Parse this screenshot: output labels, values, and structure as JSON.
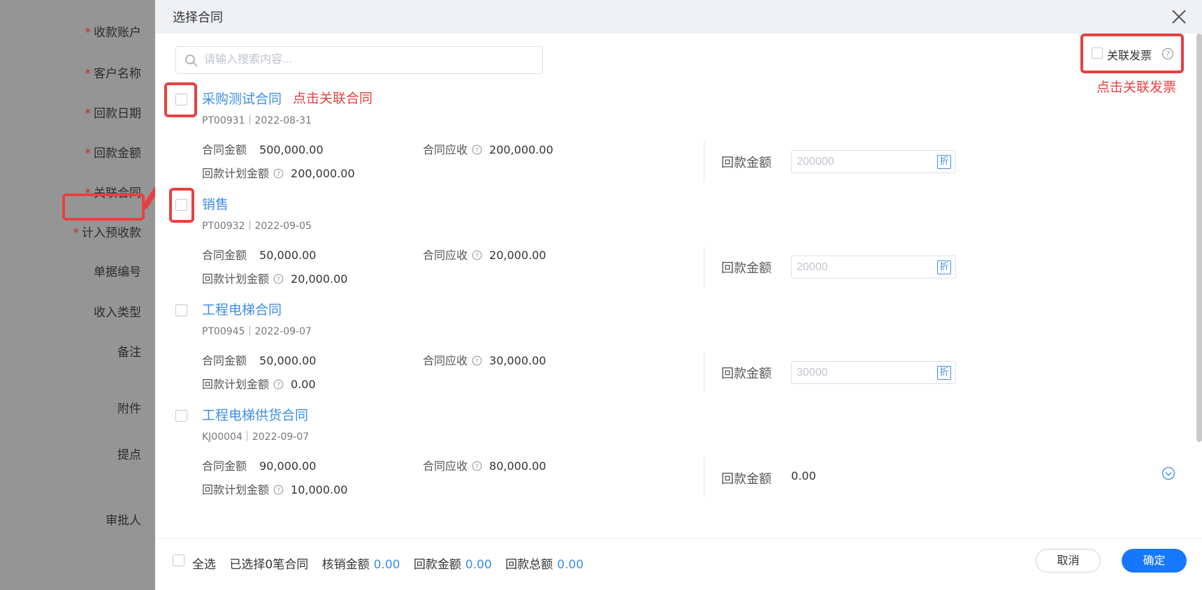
{
  "form": {
    "fields": [
      {
        "label": "收款账户",
        "required": true
      },
      {
        "label": "客户名称",
        "required": true
      },
      {
        "label": "回款日期",
        "required": true
      },
      {
        "label": "回款金额",
        "required": true
      },
      {
        "label": "关联合同",
        "required": true
      },
      {
        "label": "计入预收款",
        "required": true
      },
      {
        "label": "单据编号",
        "required": false
      },
      {
        "label": "收入类型",
        "required": false
      },
      {
        "label": "备注",
        "required": false
      },
      {
        "label": "附件",
        "required": false
      },
      {
        "label": "提点",
        "required": false
      },
      {
        "label": "审批人",
        "required": false
      }
    ],
    "required_mark": "*"
  },
  "modal": {
    "title": "选择合同",
    "search_placeholder": "请输入搜索内容...",
    "invoice_label": "关联发票",
    "invoice_note": "点击关联发票",
    "contract_note": "点击关联合同",
    "labels": {
      "contract_amount": "合同金额",
      "receivable": "合同应收",
      "plan_amount": "回款计划金额",
      "payment_amount": "回款金额"
    },
    "contracts": [
      {
        "name": "采购测试合同",
        "meta": "PT00931｜2022-08-31",
        "amount": "500,000.00",
        "receivable": "200,000.00",
        "plan": "200,000.00",
        "payment_placeholder": "200000",
        "discount_icon": "折"
      },
      {
        "name": "销售",
        "meta": "PT00932｜2022-09-05",
        "amount": "50,000.00",
        "receivable": "20,000.00",
        "plan": "20,000.00",
        "payment_placeholder": "20000",
        "discount_icon": "折"
      },
      {
        "name": "工程电梯合同",
        "meta": "PT00945｜2022-09-07",
        "amount": "50,000.00",
        "receivable": "30,000.00",
        "plan": "0.00",
        "payment_placeholder": "30000",
        "discount_icon": "折"
      },
      {
        "name": "工程电梯供货合同",
        "meta": "KJ00004｜2022-09-07",
        "amount": "90,000.00",
        "receivable": "80,000.00",
        "plan": "10,000.00",
        "payment_value": "0.00"
      }
    ],
    "footer": {
      "select_all": "全选",
      "selected_count": "已选择0笔合同",
      "writeoff_label": "核销金额",
      "writeoff_value": "0.00",
      "payment_label": "回款金额",
      "payment_value": "0.00",
      "total_label": "回款总额",
      "total_value": "0.00",
      "cancel": "取消",
      "confirm": "确定"
    }
  },
  "colors": {
    "accent": "#3d8ee8",
    "primary_button": "#1677ff",
    "annotation": "#e84040"
  }
}
